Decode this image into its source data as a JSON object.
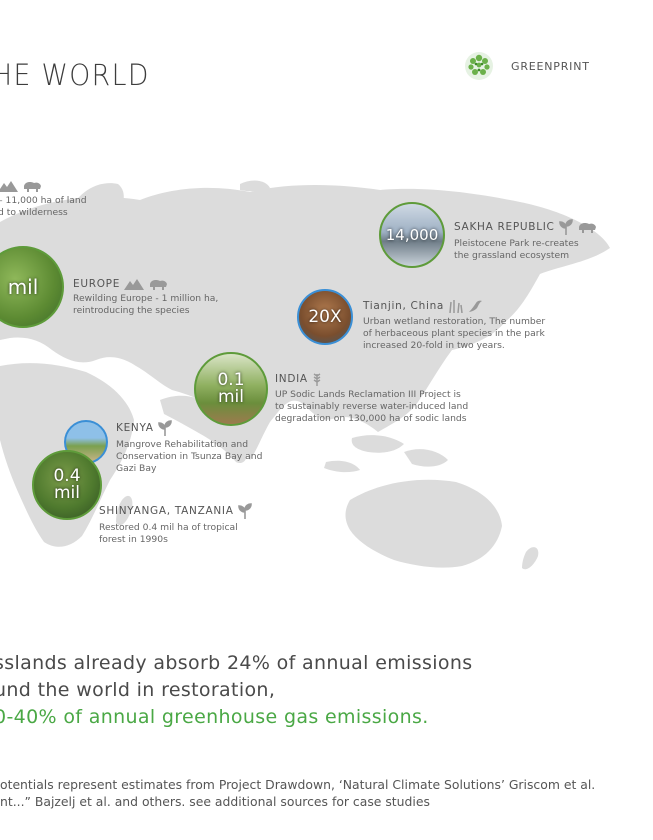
{
  "title": "HE WORLD",
  "brand": {
    "label": "GREENPRINT",
    "logo_icon": "leaf-logo-icon"
  },
  "cases": [
    {
      "header": "",
      "description": [
        "– 11,000 ha of land",
        "d to wilderness"
      ],
      "icons": [
        "mountain-icon",
        "bison-icon"
      ]
    },
    {
      "header": "EUROPE",
      "description": [
        "Rewilding Europe - 1 million ha,",
        "reintroducing the species"
      ],
      "icons": [
        "mountain-icon",
        "bison-icon"
      ],
      "circle_value": "mil"
    },
    {
      "header": "SAKHA REPUBLIC",
      "description": [
        "Pleistocene Park re-creates",
        "the grassland ecosystem"
      ],
      "icons": [
        "plant-icon",
        "bison-icon"
      ],
      "circle_value": "14,000"
    },
    {
      "header": "Tianjin, China",
      "description": [
        "Urban wetland restoration, The number",
        "of herbaceous plant species in the park",
        "increased 20-fold in two years."
      ],
      "icons": [
        "grass-icon",
        "bird-icon"
      ],
      "circle_value": "20X"
    },
    {
      "header": "INDIA",
      "description": [
        "UP Sodic Lands Reclamation III Project is",
        "to sustainably reverse water-induced land",
        "degradation on 130,000 ha of sodic lands"
      ],
      "icons": [
        "wheat-icon"
      ],
      "circle_value": "0.1\nmil"
    },
    {
      "header": "KENYA",
      "description": [
        "Mangrove Rehabilitation and",
        "Conservation in Tsunza Bay and",
        "Gazi Bay"
      ],
      "icons": [
        "plant-icon"
      ]
    },
    {
      "header": "SHINYANGA, TANZANIA",
      "description": [
        "Restored 0.4 mil ha of tropical",
        "forest in 1990s"
      ],
      "icons": [
        "plant-icon"
      ],
      "circle_value": "0.4\nmil"
    }
  ],
  "summary": {
    "line1": "sslands already absorb 24% of annual emissions",
    "line2": "und the world in restoration,",
    "line3": "0-40% of annual greenhouse gas emissions."
  },
  "footnote": {
    "line1": "otentials represent estimates from Project Drawdown, ‘Natural Climate Solutions’ Griscom et al.",
    "line2": "nt...” Bajzelj et al. and others. see additional sources for case studies"
  },
  "colors": {
    "accent_green": "#4aa845",
    "map_land": "#dcdcdc",
    "ring_green": "#5e9b3a",
    "ring_blue": "#3a8fd6"
  }
}
